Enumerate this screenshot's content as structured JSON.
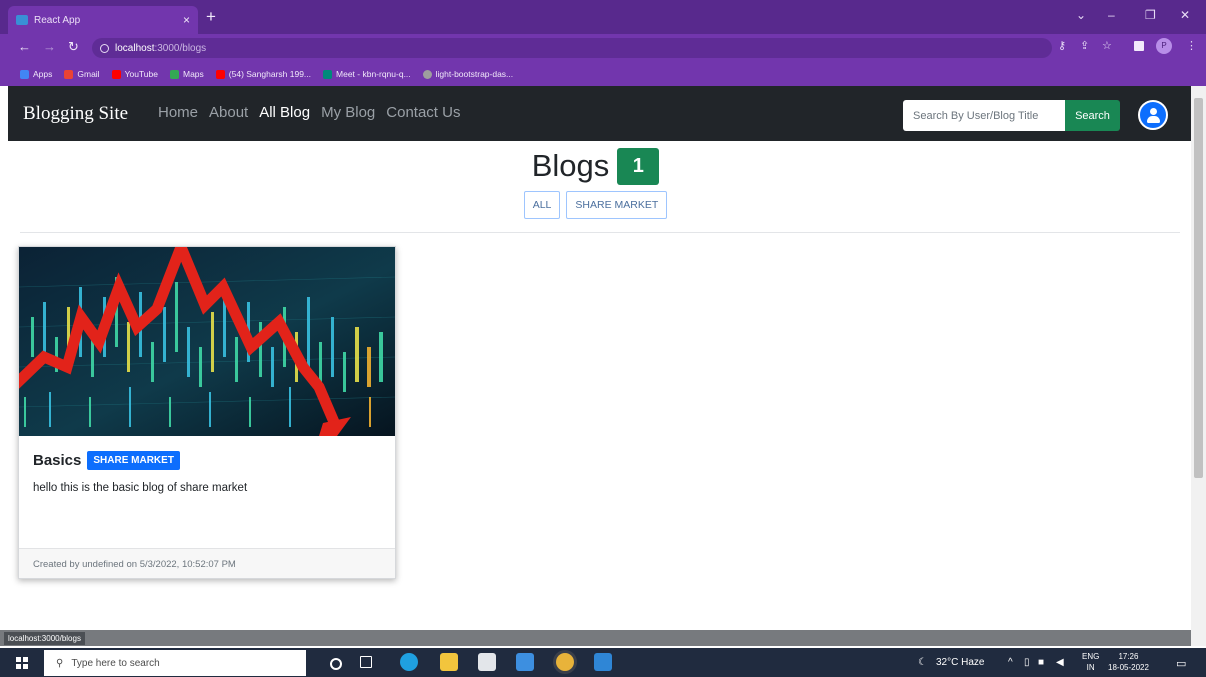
{
  "browser": {
    "tab_title": "React App",
    "tab_close": "×",
    "new_tab": "+",
    "url_host": "localhost",
    "url_path": ":3000/blogs",
    "bookmarks": [
      {
        "label": "Apps",
        "color": "#4285f4"
      },
      {
        "label": "Gmail",
        "color": "#ea4335"
      },
      {
        "label": "YouTube",
        "color": "#ff0000"
      },
      {
        "label": "Maps",
        "color": "#34a853"
      },
      {
        "label": "(54) Sangharsh 199...",
        "color": "#ff0000"
      },
      {
        "label": "Meet - kbn-rqnu-q...",
        "color": "#00897b"
      },
      {
        "label": "light-bootstrap-das...",
        "color": "#9e9e9e"
      }
    ],
    "profile_initial": "P",
    "status_url": "localhost:3000/blogs"
  },
  "navbar": {
    "brand": "Blogging Site",
    "links": [
      {
        "label": "Home",
        "active": false
      },
      {
        "label": "About",
        "active": false
      },
      {
        "label": "All Blog",
        "active": true
      },
      {
        "label": "My Blog",
        "active": false
      },
      {
        "label": "Contact Us",
        "active": false
      }
    ],
    "search_placeholder": "Search By User/Blog Title",
    "search_button": "Search"
  },
  "page": {
    "title": "Blogs",
    "count": "1",
    "filters": [
      "ALL",
      "SHARE MARKET"
    ]
  },
  "blogs": [
    {
      "title": "Basics",
      "category": "SHARE MARKET",
      "text": "hello this is the basic blog of share market",
      "footer": "Created by undefined on 5/3/2022, 10:52:07 PM"
    }
  ],
  "taskbar": {
    "search_placeholder": "Type here to search",
    "weather": "32°C Haze",
    "language": "ENG",
    "region": "IN",
    "time": "17:26",
    "date": "18-05-2022"
  },
  "colors": {
    "chrome_dark": "#58298d",
    "chrome": "#7236ad",
    "navbar": "#212529",
    "success": "#198754",
    "primary": "#0d6efd"
  }
}
